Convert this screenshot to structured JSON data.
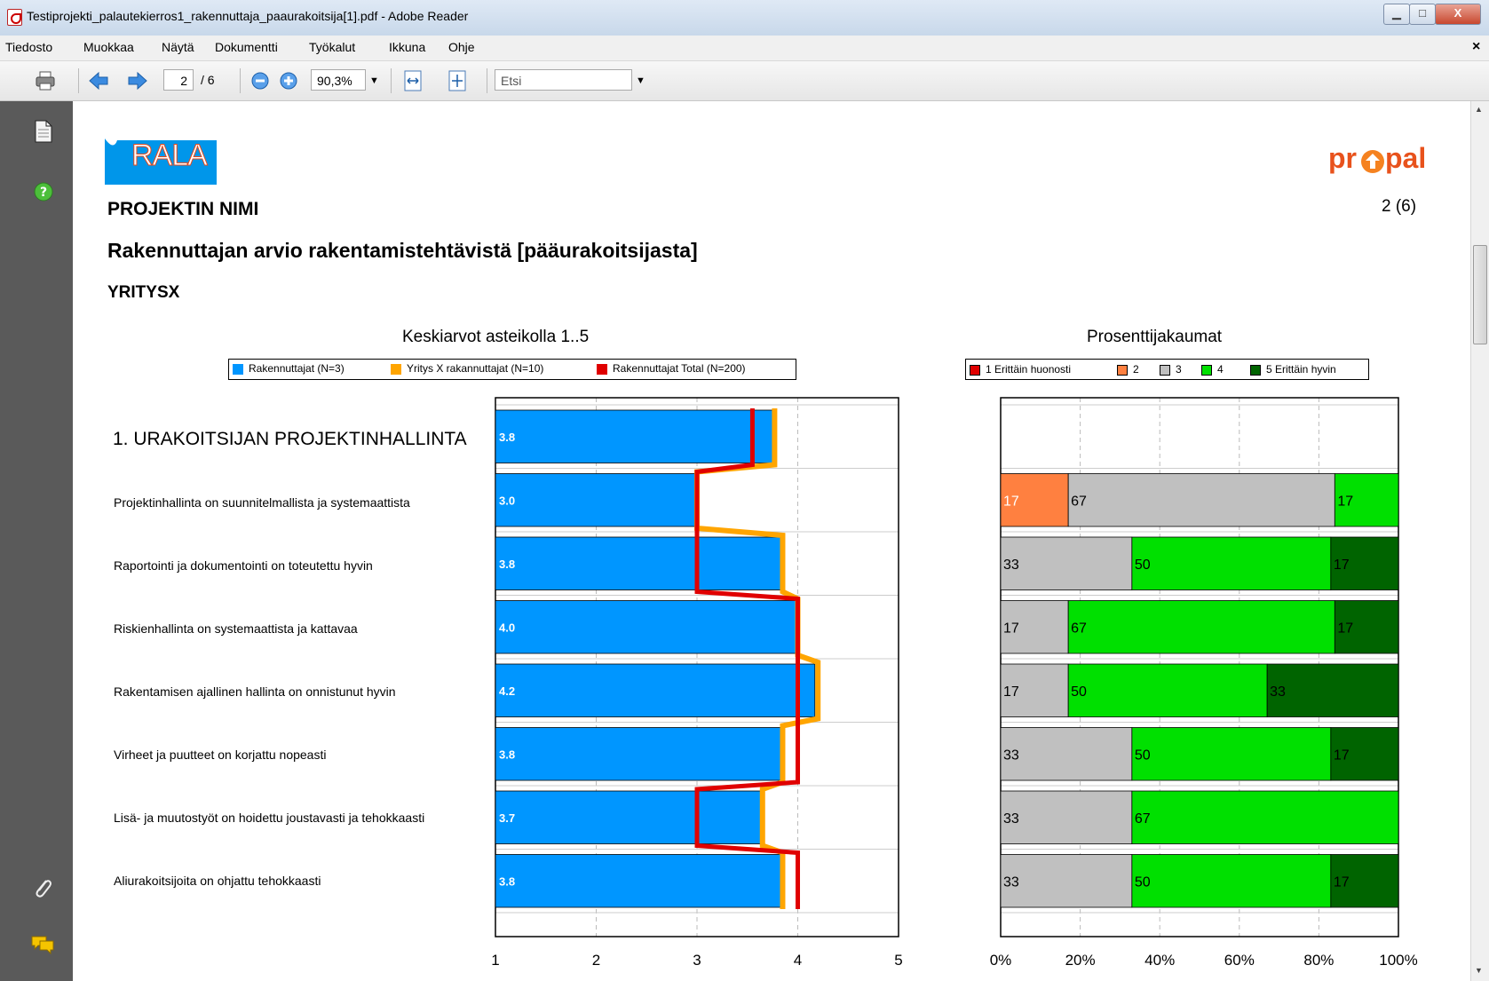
{
  "window": {
    "title": "Testiprojekti_palautekierros1_rakennuttaja_paaurakoitsija[1].pdf - Adobe Reader",
    "min_glyph": "▁",
    "max_glyph": "□",
    "close_glyph": "X"
  },
  "menu": {
    "items": [
      "Tiedosto",
      "Muokkaa",
      "Näytä",
      "Dokumentti",
      "Työkalut",
      "Ikkuna",
      "Ohje"
    ],
    "close_glyph": "×"
  },
  "toolbar": {
    "page_current": "2",
    "page_total": "/ 6",
    "zoom": "90,3%",
    "search_placeholder": "Etsi",
    "icons": [
      "print-icon",
      "prev-page-icon",
      "next-page-icon",
      "zoom-out-icon",
      "zoom-in-icon",
      "fit-width-icon",
      "fit-page-icon",
      "search-dropdown-icon"
    ]
  },
  "sidebar": {
    "icons": [
      "pages-icon",
      "help-icon",
      "attachment-icon",
      "comments-icon"
    ]
  },
  "document": {
    "logo_left": "RALA",
    "logo_right": "pr pal",
    "page_number": "2 (6)",
    "heading": "PROJEKTIN NIMI",
    "subheading": "Rakennuttajan arvio rakentamistehtävistä [pääurakoitsijasta]",
    "company": "YRITYSX"
  },
  "colors": {
    "blue": "#0096ff",
    "orange": "#ffa500",
    "red": "#e00000",
    "p1": "#e00000",
    "p2": "#ff8040",
    "p3": "#c0c0c0",
    "p4": "#00e000",
    "p5": "#006400"
  },
  "chart_data": [
    {
      "type": "bar",
      "title": "Keskiarvot asteikolla 1..5",
      "legend": [
        "Rakennuttajat (N=3)",
        "Yritys X rakannuttajat (N=10)",
        "Rakennuttajat Total (N=200)"
      ],
      "legend_placement": "top",
      "categories": [
        "1. URAKOITSIJAN PROJEKTINHALLINTA",
        "Projektinhallinta on suunnitelmallista ja systemaattista",
        "Raportointi ja dokumentointi on toteutettu hyvin",
        "Riskienhallinta on systemaattista ja kattavaa",
        "Rakentamisen ajallinen hallinta on onnistunut hyvin",
        "Virheet ja puutteet on korjattu nopeasti",
        "Lisä- ja muutostyöt on hoidettu joustavasti ja tehokkaasti",
        "Aliurakoitsijoita on ohjattu tehokkaasti"
      ],
      "series": [
        {
          "name": "Rakennuttajat (N=3)",
          "values": [
            3.75,
            3.0,
            3.83,
            4.0,
            4.17,
            3.83,
            3.67,
            3.83
          ]
        },
        {
          "name": "Yritys X rakannuttajat (N=10)",
          "values": [
            3.77,
            3.0,
            3.85,
            4.0,
            4.2,
            3.85,
            3.65,
            3.85
          ]
        },
        {
          "name": "Rakennuttajat Total (N=200)",
          "values": [
            3.55,
            3.0,
            3.0,
            4.0,
            4.0,
            4.0,
            3.0,
            4.0
          ]
        }
      ],
      "value_labels": [
        "3.8",
        "3.0",
        "3.8",
        "4.0",
        "4.2",
        "3.8",
        "3.7",
        "3.8"
      ],
      "xlim": [
        1,
        5
      ],
      "ticks": [
        "1",
        "2",
        "3",
        "4",
        "5"
      ],
      "grid": true
    },
    {
      "type": "bar",
      "stacked": true,
      "title": "Prosenttijakaumat",
      "legend": [
        "1 Erittäin huonosti",
        "2",
        "3",
        "4",
        "5 Erittäin hyvin"
      ],
      "legend_placement": "top",
      "rows": [
        [
          0,
          0,
          0,
          0,
          0
        ],
        [
          0,
          17,
          67,
          17,
          0
        ],
        [
          0,
          0,
          33,
          50,
          17
        ],
        [
          0,
          0,
          17,
          67,
          17
        ],
        [
          0,
          0,
          17,
          50,
          33
        ],
        [
          0,
          0,
          33,
          50,
          17
        ],
        [
          0,
          0,
          33,
          67,
          0
        ],
        [
          0,
          0,
          33,
          50,
          17
        ]
      ],
      "xlim": [
        0,
        100
      ],
      "ticks": [
        "0%",
        "20%",
        "40%",
        "60%",
        "80%",
        "100%"
      ],
      "grid": true
    }
  ]
}
